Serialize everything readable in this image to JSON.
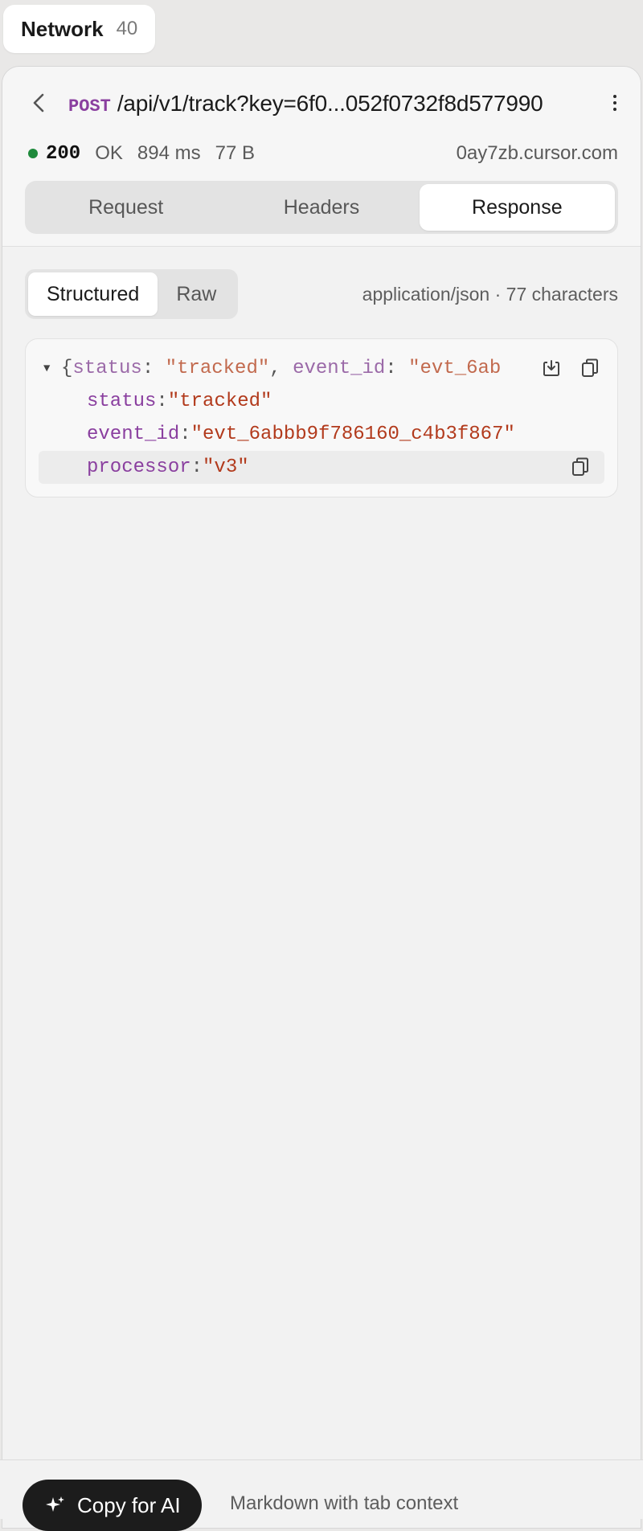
{
  "tab": {
    "title": "Network",
    "count": "40"
  },
  "request": {
    "method": "POST",
    "url": "/api/v1/track?key=6f0...052f0732f8d577990",
    "status_code": "200",
    "status_text": "OK",
    "duration": "894 ms",
    "size": "77 B",
    "host": "0ay7zb.cursor.com",
    "status_color": "#1f8a3c"
  },
  "sections": {
    "items": [
      "Request",
      "Headers",
      "Response"
    ],
    "active": "Response"
  },
  "view": {
    "structured": "Structured",
    "raw": "Raw",
    "active": "Structured",
    "content_meta": "application/json · 77 characters"
  },
  "json": {
    "summary": {
      "open": "{",
      "k1": "status",
      "v1": "\"tracked\"",
      "sep": ", ",
      "k2": "event_id",
      "v2": "\"evt_6ab"
    },
    "rows": [
      {
        "key": "status",
        "value": "\"tracked\""
      },
      {
        "key": "event_id",
        "value": "\"evt_6abbb9f786160_c4b3f867\""
      },
      {
        "key": "processor",
        "value": "\"v3\""
      }
    ]
  },
  "footer": {
    "copy_label": "Copy for AI",
    "note": "Markdown with tab context"
  },
  "icons": {
    "back": "chevron-left-icon",
    "more": "more-vertical-icon",
    "save": "download-icon",
    "copy": "copy-icon",
    "sparkle": "sparkle-icon"
  }
}
